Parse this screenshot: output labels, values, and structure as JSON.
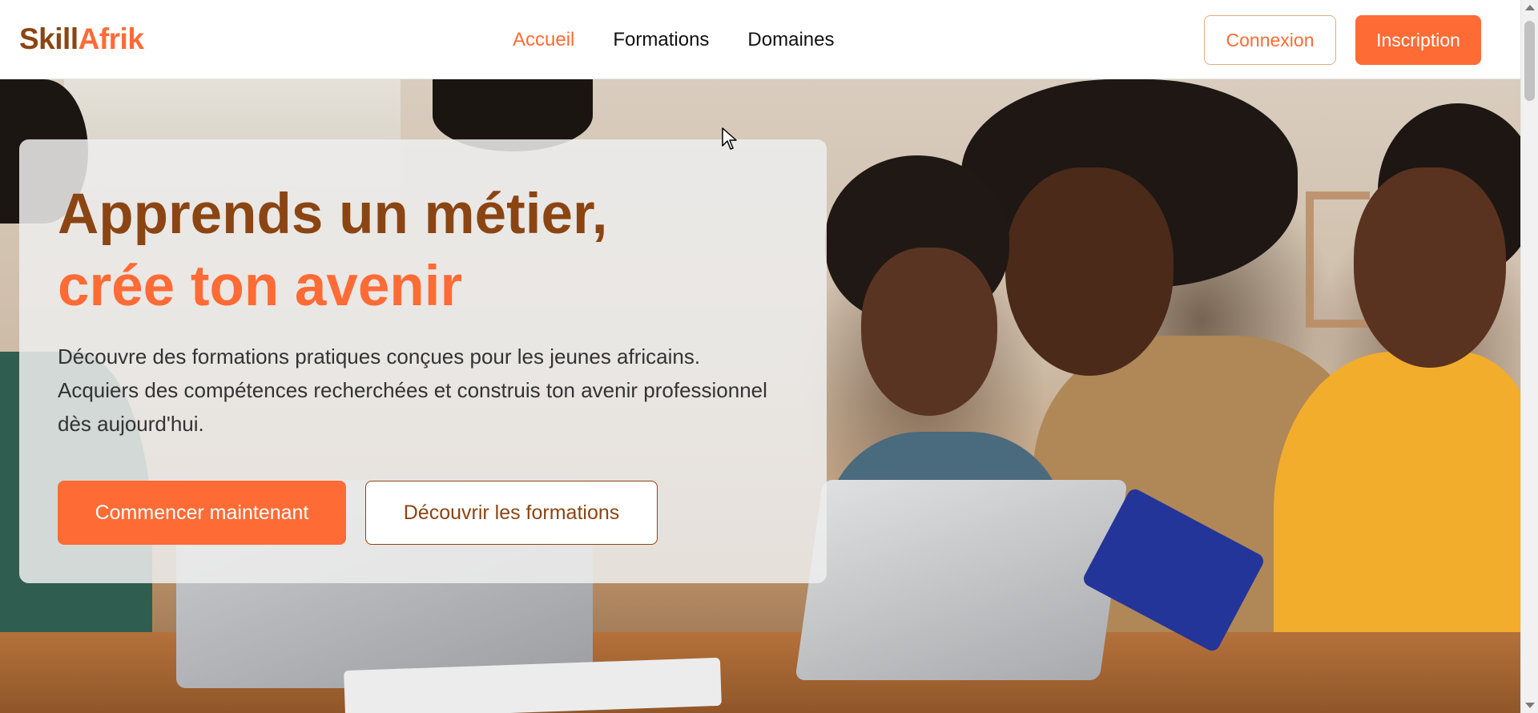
{
  "header": {
    "logo_part1": "Skill",
    "logo_part2": "Afrik",
    "nav": [
      {
        "label": "Accueil",
        "active": true
      },
      {
        "label": "Formations",
        "active": false
      },
      {
        "label": "Domaines",
        "active": false
      }
    ],
    "login_label": "Connexion",
    "signup_label": "Inscription"
  },
  "hero": {
    "title_line1": "Apprends un métier,",
    "title_line2": "crée ton avenir",
    "description": "Découvre des formations pratiques conçues pour les jeunes africains. Acquiers des compétences recherchées et construis ton avenir professionnel dès aujourd'hui.",
    "primary_button": "Commencer maintenant",
    "secondary_button": "Découvrir les formations",
    "background_image": "students-with-laptops-photo"
  },
  "colors": {
    "brand_brown": "#8b4513",
    "brand_orange": "#ff6b35"
  },
  "icons": [
    "mouse-cursor-icon",
    "scroll-up-arrow-icon",
    "scroll-down-arrow-icon"
  ]
}
